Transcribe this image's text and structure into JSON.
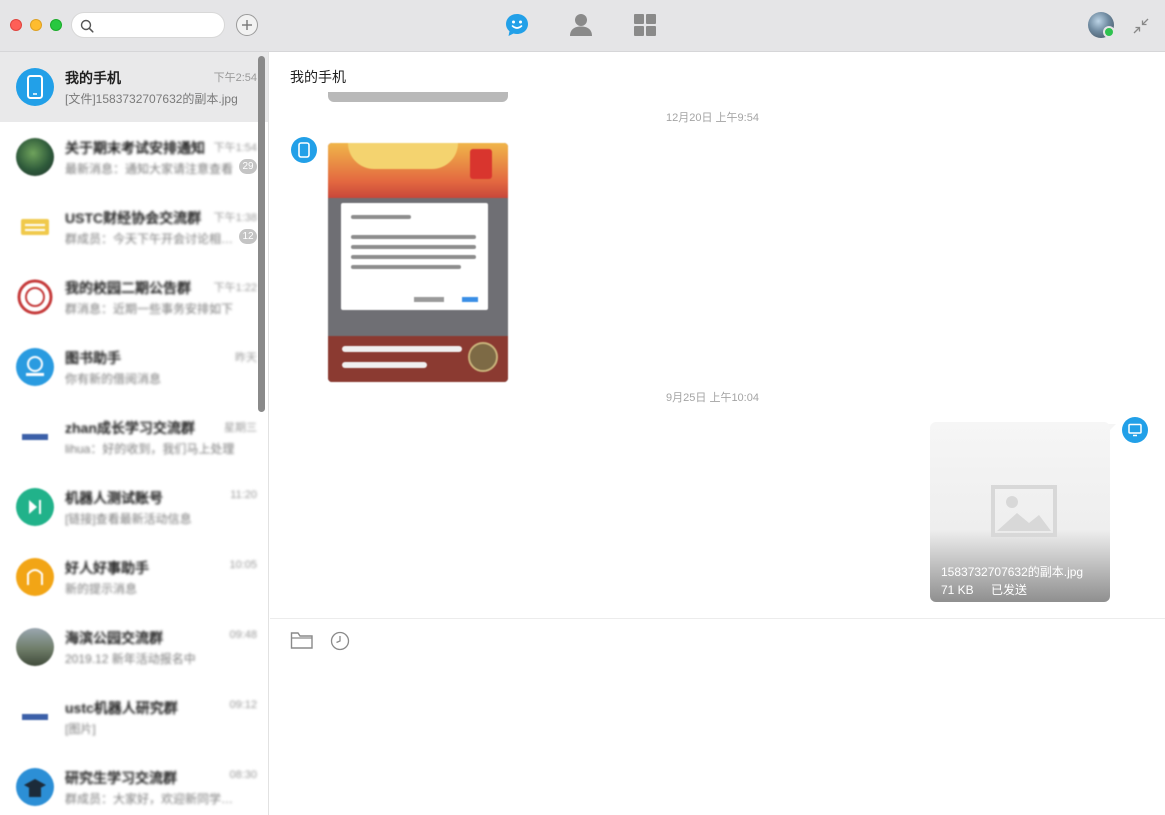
{
  "search": {
    "placeholder": "",
    "value": ""
  },
  "nav": {
    "chat_icon": "chat-bubble-smile-icon",
    "contacts_icon": "person-icon",
    "apps_icon": "apps-grid-icon"
  },
  "colors": {
    "accent": "#22a0e8",
    "topbar": "#e5e5e7",
    "online": "#2fc24f",
    "active_row": "#e9e9ea"
  },
  "conversations": [
    {
      "name": "我的手机",
      "time": "下午2:54",
      "preview": "[文件]1583732707632的副本.jpg",
      "badge": "",
      "active": true
    },
    {
      "name": "关于期末考试安排通知",
      "time": "下午1:54",
      "preview": "最新消息：通知大家请注意查看",
      "badge": "29",
      "active": false
    },
    {
      "name": "USTC财经协会交流群",
      "time": "下午1:38",
      "preview": "群成员：今天下午开会讨论相关事宜",
      "badge": "12",
      "active": false
    },
    {
      "name": "我的校园二期公告群",
      "time": "下午1:22",
      "preview": "群消息：近期一些事务安排如下",
      "badge": "",
      "active": false
    },
    {
      "name": "图书助手",
      "time": "昨天",
      "preview": "你有新的借阅消息",
      "badge": "",
      "active": false
    },
    {
      "name": "zhan成长学习交流群",
      "time": "星期三",
      "preview": "lihua：好的收到，我们马上处理",
      "badge": "",
      "active": false
    },
    {
      "name": "机器人测试账号",
      "time": "11:20",
      "preview": "[链接]查看最新活动信息",
      "badge": "",
      "active": false
    },
    {
      "name": "好人好事助手",
      "time": "10:05",
      "preview": "新的提示消息",
      "badge": "",
      "active": false
    },
    {
      "name": "海滨公园交流群",
      "time": "09:48",
      "preview": "2019.12 新年活动报名中",
      "badge": "",
      "active": false
    },
    {
      "name": "ustc机器人研究群",
      "time": "09:12",
      "preview": "[图片]",
      "badge": "",
      "active": false
    },
    {
      "name": "研究生学习交流群",
      "time": "08:30",
      "preview": "群成员：大家好，欢迎新同学加入",
      "badge": "",
      "active": false
    }
  ],
  "chat": {
    "title": "我的手机",
    "timestamp_1": "12月20日  上午9:54",
    "timestamp_2": "9月25日  上午10:04",
    "file": {
      "name": "1583732707632的副本.jpg",
      "size": "71 KB",
      "status": "已发送"
    }
  },
  "toolbar": {
    "folder_icon": "folder-icon",
    "history_icon": "clock-icon"
  },
  "compose": {
    "value": ""
  }
}
